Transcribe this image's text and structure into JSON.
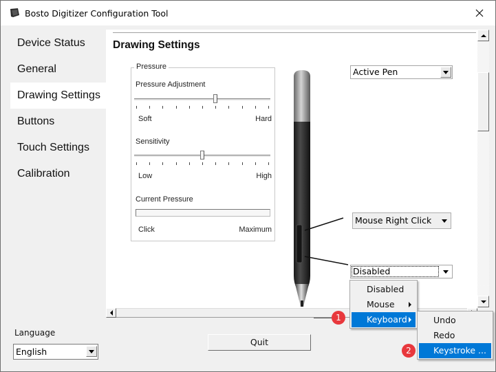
{
  "window": {
    "title": "Bosto Digitizer Configuration Tool"
  },
  "sidebar": {
    "items": [
      {
        "label": "Device Status",
        "active": false
      },
      {
        "label": "General",
        "active": false
      },
      {
        "label": "Drawing Settings",
        "active": true
      },
      {
        "label": "Buttons",
        "active": false
      },
      {
        "label": "Touch Settings",
        "active": false
      },
      {
        "label": "Calibration",
        "active": false
      }
    ]
  },
  "main": {
    "title": "Drawing Settings",
    "pressure_group": {
      "legend": "Pressure",
      "adjustment": {
        "label": "Pressure Adjustment",
        "min_label": "Soft",
        "max_label": "Hard",
        "value": 0.6,
        "ticks": 11
      },
      "sensitivity": {
        "label": "Sensitivity",
        "min_label": "Low",
        "max_label": "High",
        "value": 0.5,
        "ticks": 11
      },
      "current_pressure": {
        "label": "Current Pressure",
        "min_label": "Click",
        "max_label": "Maximum",
        "value": 0
      }
    },
    "pen_type_select": {
      "value": "Active Pen"
    },
    "upper_button_select": {
      "value": "Mouse Right Click"
    },
    "lower_button_select": {
      "value": "Disabled"
    }
  },
  "context_menu": {
    "items": [
      {
        "label": "Disabled",
        "submenu": false,
        "highlighted": false
      },
      {
        "label": "Mouse",
        "submenu": true,
        "highlighted": false
      },
      {
        "label": "Keyboard",
        "submenu": true,
        "highlighted": true
      }
    ],
    "keyboard_submenu": [
      {
        "label": "Undo",
        "highlighted": false
      },
      {
        "label": "Redo",
        "highlighted": false
      },
      {
        "label": "Keystroke ...",
        "highlighted": true
      }
    ]
  },
  "annotations": {
    "step1": "1",
    "step2": "2"
  },
  "footer": {
    "language_label": "Language",
    "language_value": "English",
    "quit_label": "Quit"
  },
  "colors": {
    "highlight": "#0078d7",
    "badge": "#e8383d"
  }
}
